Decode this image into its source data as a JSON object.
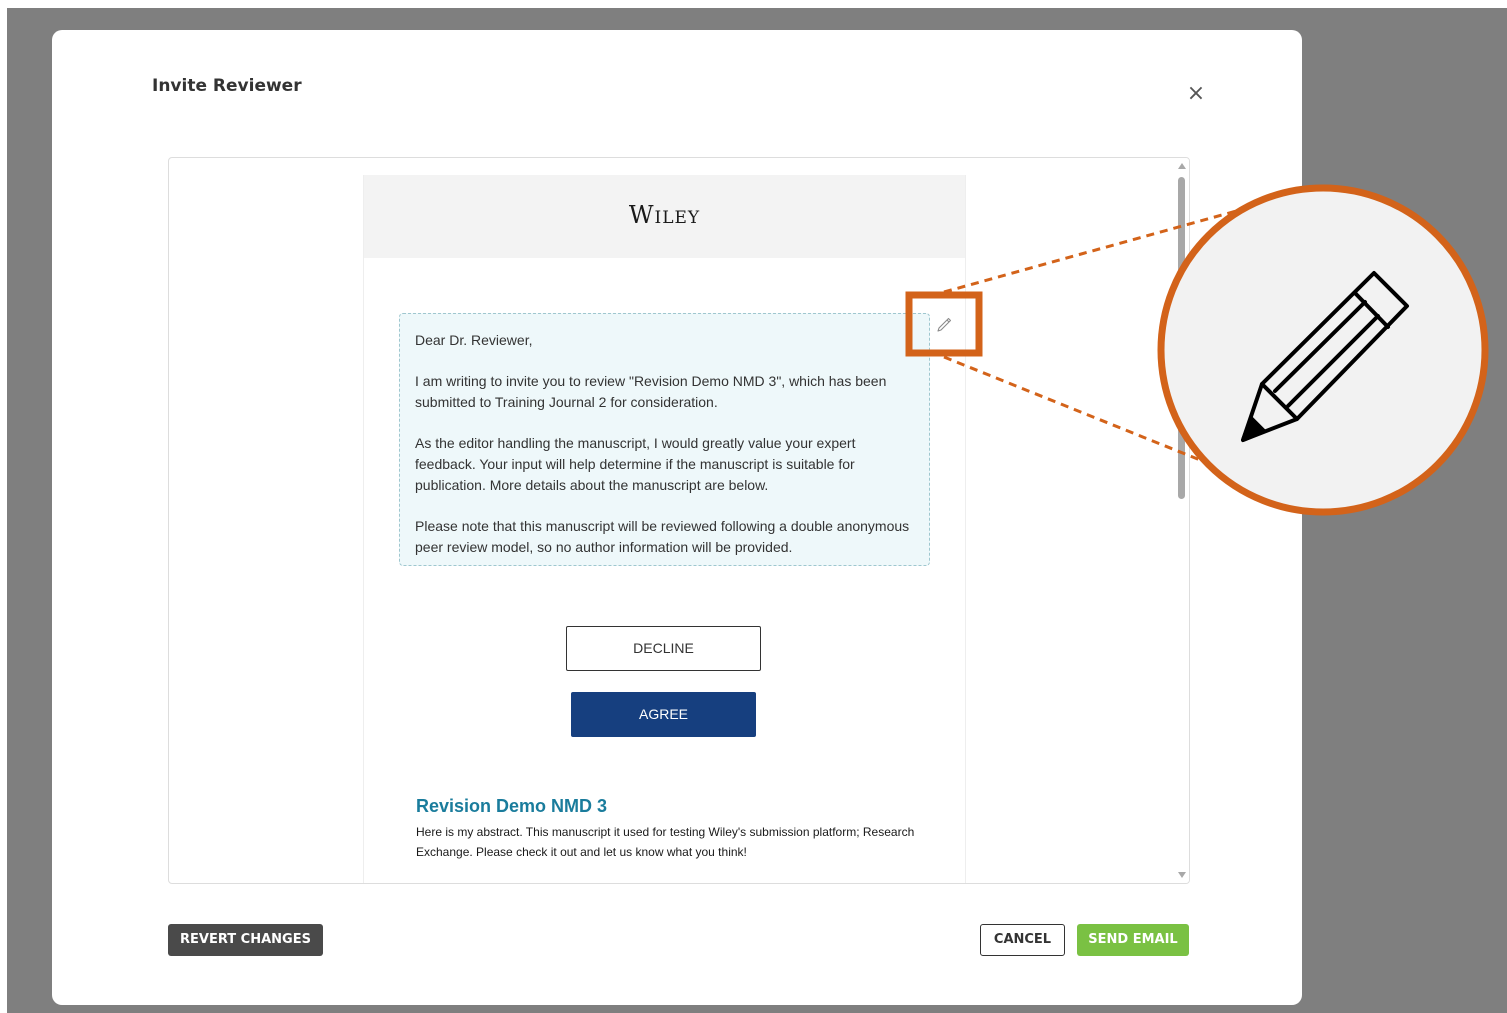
{
  "modal": {
    "title": "Invite Reviewer",
    "close_symbol": "×"
  },
  "email": {
    "logo_text": "Wiley",
    "greeting": "Dear Dr. Reviewer,",
    "paragraphs": [
      "I am writing to invite you to review \"Revision Demo NMD 3\", which has been submitted to Training Journal 2 for consideration.",
      "As the editor handling the manuscript, I would greatly value your expert feedback. Your input will help determine if the manuscript is suitable for publication. More details about the manuscript are below.",
      "Please note that this manuscript will be reviewed following a double anonymous peer review model, so no author information will be provided."
    ],
    "decline_label": "DECLINE",
    "agree_label": "AGREE",
    "manuscript_title": "Revision Demo NMD 3",
    "abstract": "Here is my abstract. This manuscript it used for testing Wiley's submission platform; Research Exchange. Please check it out and let us know what you think!"
  },
  "footer": {
    "revert_label": "REVERT CHANGES",
    "cancel_label": "CANCEL",
    "send_label": "SEND EMAIL"
  },
  "icons": {
    "edit": "pencil-icon",
    "close": "close-icon"
  },
  "colors": {
    "backdrop": "#7f7f7f",
    "highlight_orange": "#d3631a",
    "agree_blue": "#163f7f",
    "send_green": "#7ac143",
    "revert_dark": "#4a4a4a",
    "title_teal": "#1a7c9c",
    "editable_bg": "#eef8fa"
  }
}
